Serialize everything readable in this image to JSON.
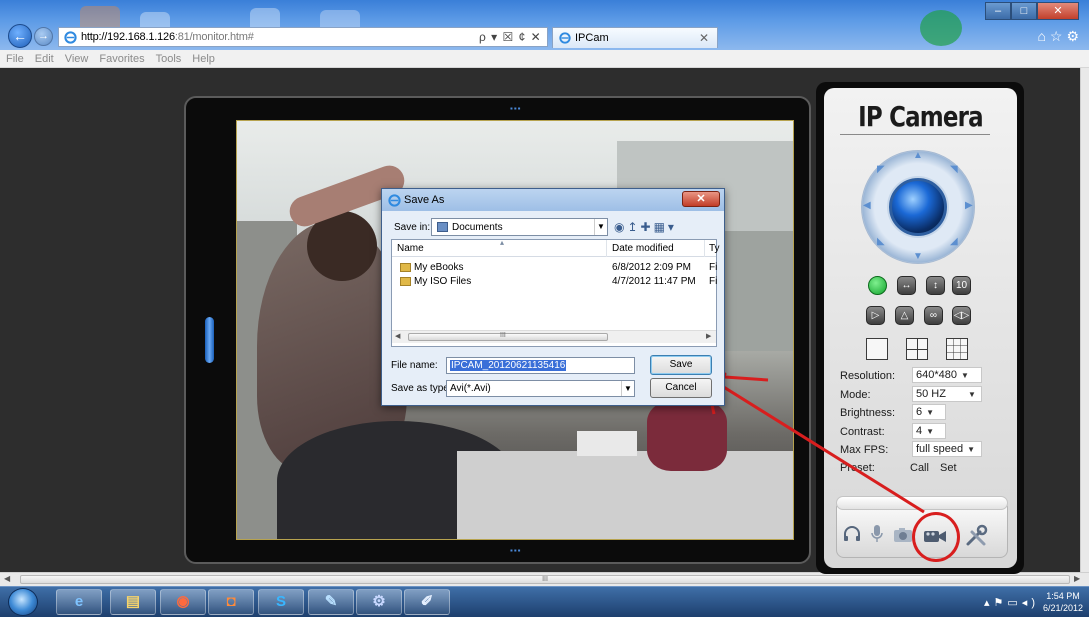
{
  "browser": {
    "address_host": "http://192.168.1.126",
    "address_rest": ":81/monitor.htm#",
    "address_tools": "ρ ▾ ☒ ¢ ✕",
    "tab_title": "IPCam",
    "tab_close": "✕",
    "window_buttons": {
      "minimize": "–",
      "maximize": "□",
      "close": "✕"
    },
    "menu": [
      "File",
      "Edit",
      "View",
      "Favorites",
      "Tools",
      "Help"
    ]
  },
  "scrollbar": {
    "thumb_label": "III"
  },
  "camera_panel": {
    "title": "IP Camera",
    "controls_row1": [
      "",
      "↔",
      "↕",
      "10"
    ],
    "controls_row2": [
      "▷",
      "△",
      "∞",
      "◁▷"
    ],
    "settings": {
      "resolution": {
        "label": "Resolution:",
        "value": "640*480"
      },
      "mode": {
        "label": "Mode:",
        "value": "50 HZ"
      },
      "brightness": {
        "label": "Brightness:",
        "value": "6"
      },
      "contrast": {
        "label": "Contrast:",
        "value": "4"
      },
      "max_fps": {
        "label": "Max FPS:",
        "value": "full speed"
      },
      "preset": {
        "label": "Preset:",
        "call": "Call",
        "set": "Set"
      }
    },
    "tools": [
      "headphones-icon",
      "microphone-icon",
      "snapshot-icon",
      "record-icon",
      "settings-tools-icon"
    ]
  },
  "dialog": {
    "title": "Save As",
    "save_in_label": "Save in:",
    "save_in_value": "Documents",
    "columns": {
      "name": "Name",
      "date": "Date modified",
      "type": "Ty"
    },
    "files": [
      {
        "name": "My eBooks",
        "date": "6/8/2012 2:09 PM",
        "type": "Fi"
      },
      {
        "name": "My ISO Files",
        "date": "4/7/2012 11:47 PM",
        "type": "Fi"
      }
    ],
    "list_scroll_label": "III",
    "file_name_label": "File name:",
    "file_name_value": "IPCAM_20120621135416",
    "save_type_label": "Save as type:",
    "save_type_value": "Avi(*.Avi)",
    "save_button": "Save",
    "cancel_button": "Cancel",
    "close_button": "✕"
  },
  "taskbar": {
    "apps": [
      "e",
      "▤",
      "◉",
      "◘",
      "S",
      "✎",
      "⚙",
      "✐"
    ],
    "clock_time": "1:54 PM",
    "clock_date": "6/21/2012"
  },
  "colors": {
    "annotation_red": "#d81e1e",
    "accent_blue": "#1b69d6",
    "record_button_green": "#11a32c"
  }
}
